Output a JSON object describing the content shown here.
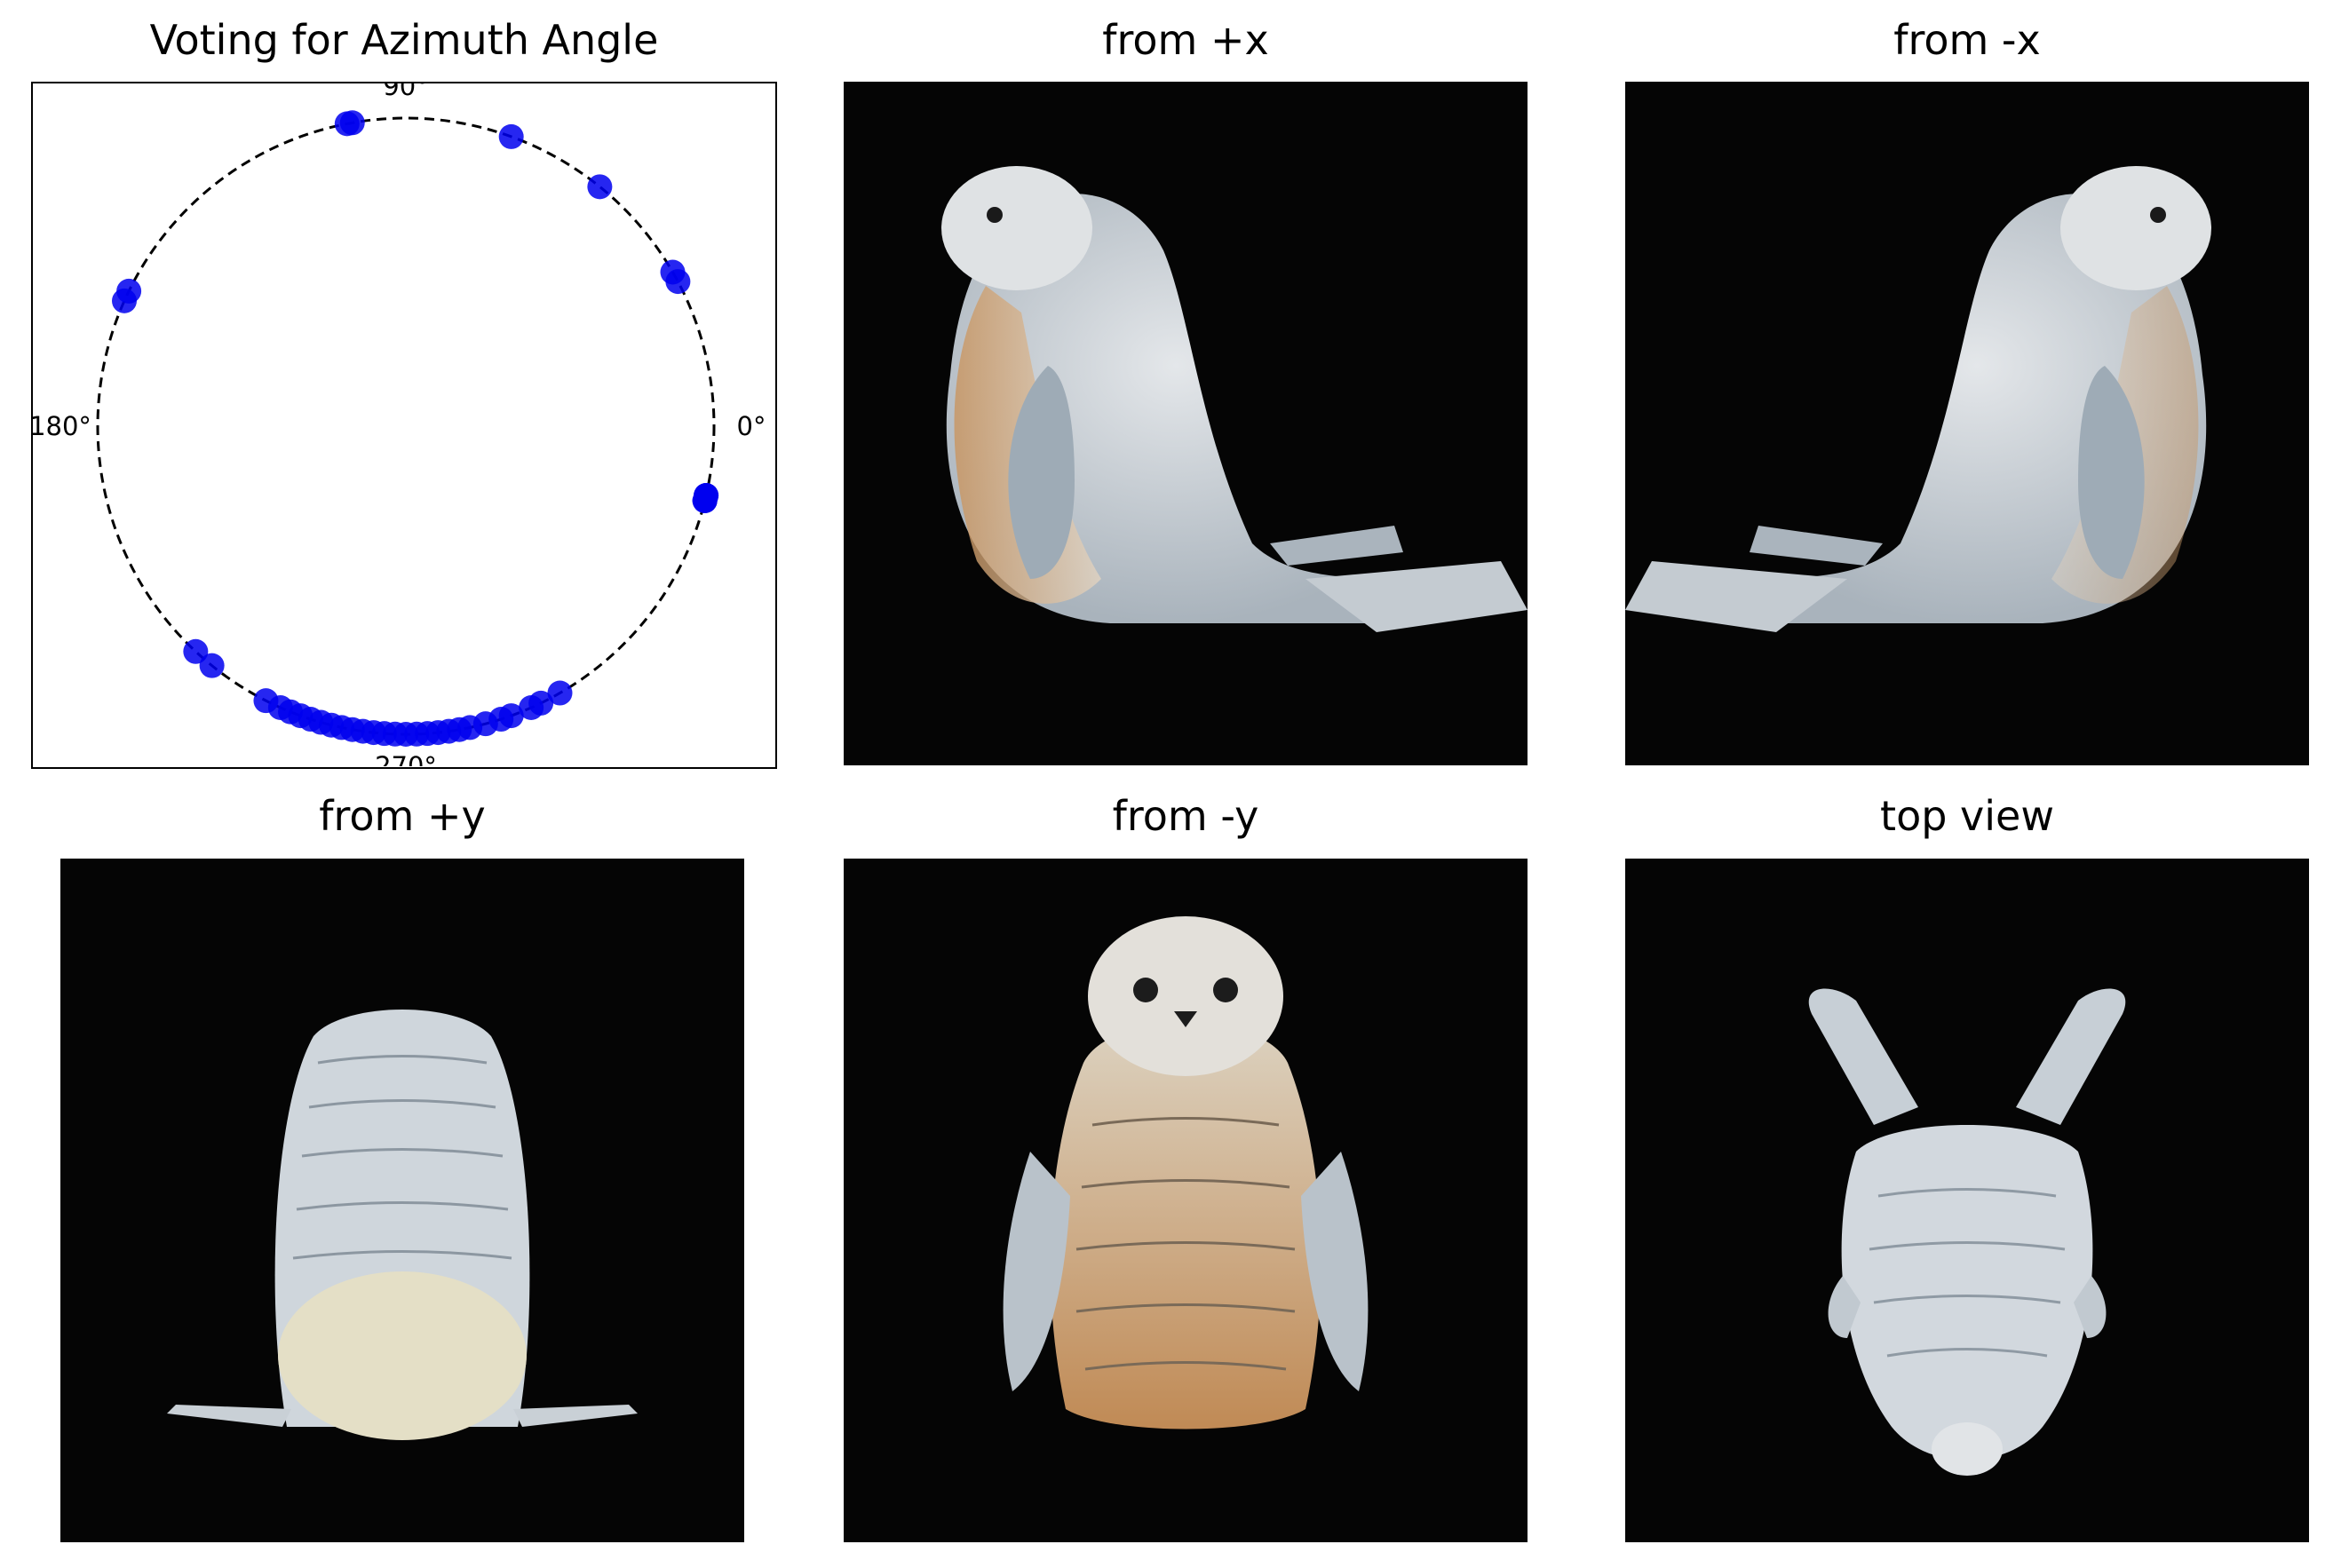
{
  "panels": {
    "chart_title": "Voting for Azimuth Angle",
    "view_px": "from +x",
    "view_nx": "from -x",
    "view_py": "from +y",
    "view_ny": "from -y",
    "view_top": "top view"
  },
  "chart_data": {
    "type": "scatter",
    "title": "Voting for Azimuth Angle",
    "projection": "circular",
    "xlabel": "",
    "ylabel": "",
    "grid": false,
    "angle_labels": [
      "0°",
      "90°",
      "180°",
      "270°"
    ],
    "angle_label_values": [
      0,
      90,
      180,
      270
    ],
    "circle_style": "dashed",
    "point_color": "#0000ee",
    "series": [
      {
        "azimuth_deg": [
          28,
          30,
          51,
          70,
          100,
          101,
          154,
          156,
          -14,
          -14,
          -13,
          -13,
          -13,
          -14,
          -60,
          -64,
          -66,
          -70,
          -72,
          -75,
          -78,
          -80,
          -82,
          -84,
          -86,
          -88,
          -90,
          -92,
          -94,
          -96,
          -98,
          -100,
          -102,
          -104,
          -106,
          -108,
          -110,
          -112,
          -114,
          -117,
          -129,
          -133
        ]
      }
    ],
    "views": [
      {
        "label": "from +x"
      },
      {
        "label": "from -x"
      },
      {
        "label": "from +y"
      },
      {
        "label": "from -y"
      },
      {
        "label": "top view"
      }
    ],
    "colors": {
      "seal_body": "#cdd3d8",
      "seal_belly": "#c7a27a",
      "background": "#050505"
    }
  }
}
